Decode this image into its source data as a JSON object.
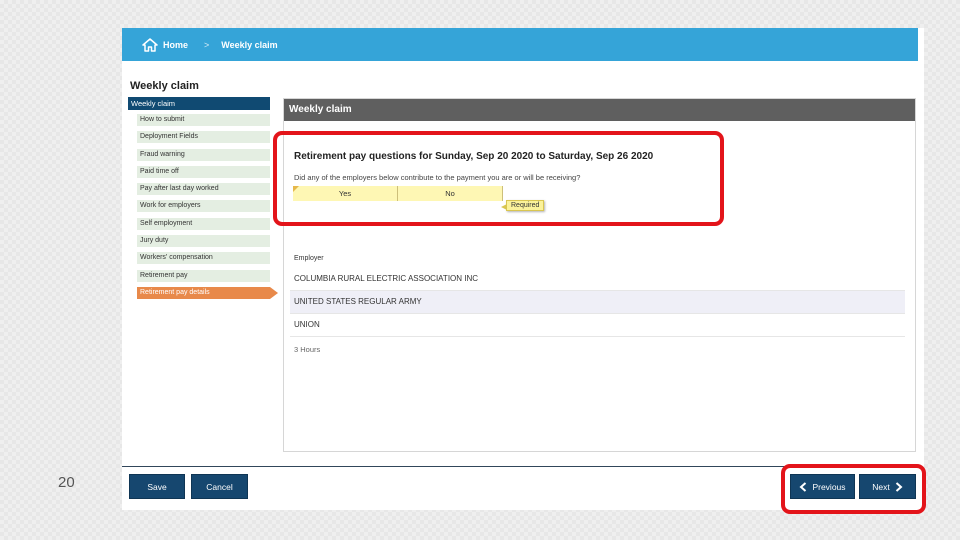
{
  "slide_number": "20",
  "breadcrumb": {
    "home": "Home",
    "current": "Weekly claim"
  },
  "page_title": "Weekly claim",
  "sidebar": {
    "header": "Weekly claim",
    "items": [
      {
        "label": "How to submit"
      },
      {
        "label": "Deployment Fields"
      },
      {
        "label": "Fraud warning"
      },
      {
        "label": "Paid time off"
      },
      {
        "label": "Pay after last day worked"
      },
      {
        "label": "Work for employers"
      },
      {
        "label": "Self employment"
      },
      {
        "label": "Jury duty"
      },
      {
        "label": "Workers' compensation"
      },
      {
        "label": "Retirement pay"
      },
      {
        "label": "Retirement pay details",
        "active": true
      }
    ]
  },
  "main": {
    "header": "Weekly claim",
    "question_title": "Retirement pay questions for Sunday, Sep 20 2020 to Saturday, Sep 26 2020",
    "question_text": "Did any of the employers below contribute to the payment you are or will be receiving?",
    "options": [
      "Yes",
      "No"
    ],
    "required_label": "Required",
    "employer_label": "Employer",
    "employers": [
      "COLUMBIA RURAL ELECTRIC ASSOCIATION INC",
      "UNITED STATES REGULAR ARMY",
      "UNION"
    ],
    "hours_text": "3 Hours"
  },
  "buttons": {
    "save": "Save",
    "cancel": "Cancel",
    "previous": "Previous",
    "next": "Next"
  },
  "colors": {
    "topbar": "#35a4d8",
    "nav_active": "#e8894a",
    "button": "#16476f",
    "highlight": "#e3141a"
  }
}
